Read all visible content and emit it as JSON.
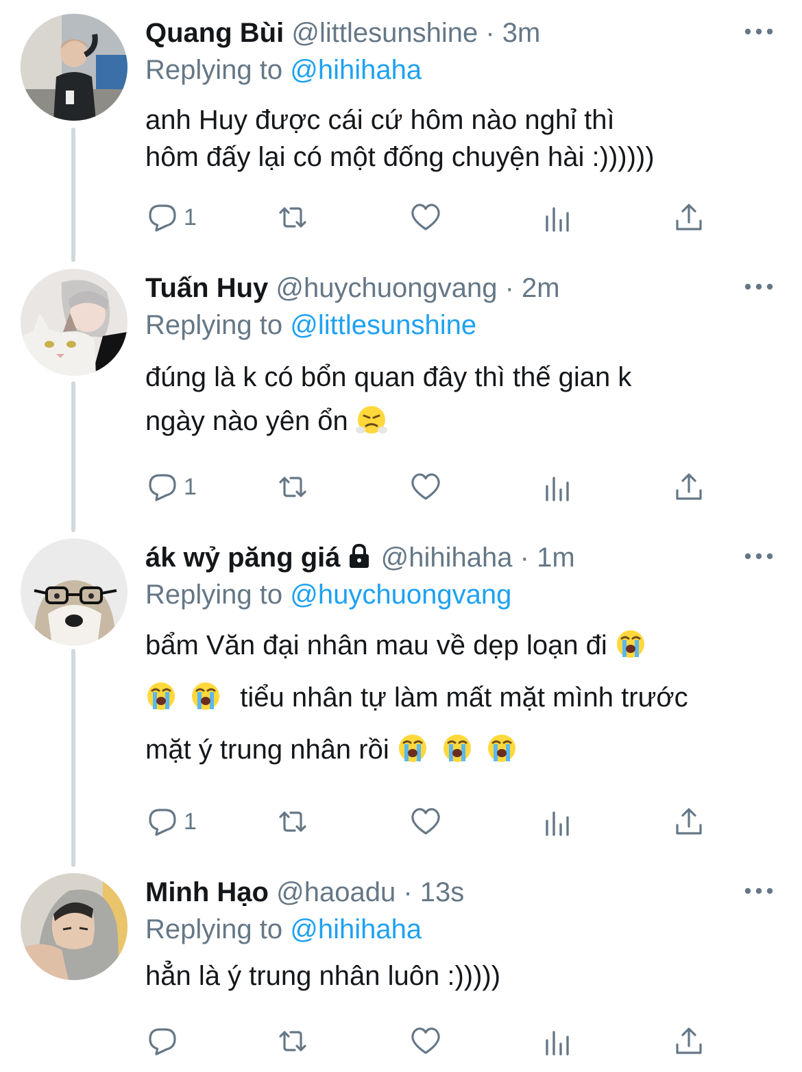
{
  "tweets": [
    {
      "display_name": "Quang Bùi",
      "handle": "@littlesunshine",
      "time": "3m",
      "separator": "·",
      "reply_prefix": "Replying to",
      "reply_to": "@hihihaha",
      "text_lines": [
        "anh Huy được cái cứ hôm nào nghỉ thì",
        "hôm đấy lại có một đống chuyện hài :))))))"
      ],
      "reply_count": "1"
    },
    {
      "display_name": "Tuấn Huy",
      "handle": "@huychuongvang",
      "time": "2m",
      "separator": "·",
      "reply_prefix": "Replying to",
      "reply_to": "@littlesunshine",
      "text_lines": [
        "đúng là k có bổn quan đây thì thế gian k",
        "ngày nào yên ổn"
      ],
      "emoji": "face-with-steam-from-nose",
      "reply_count": "1"
    },
    {
      "display_name": "ák wỷ păng giá",
      "locked": true,
      "handle": "@hihihaha",
      "time": "1m",
      "separator": "·",
      "reply_prefix": "Replying to",
      "reply_to": "@huychuongvang",
      "text_lines": [
        "bẩm Văn đại nhân mau về dẹp loạn đi",
        "tiểu nhân tự làm mất mặt mình trước",
        "mặt ý trung nhân rồi"
      ],
      "emoji": "loudly-crying-face",
      "reply_count": "1"
    },
    {
      "display_name": "Minh Hạo",
      "handle": "@haoadu",
      "time": "13s",
      "separator": "·",
      "reply_prefix": "Replying to",
      "reply_to": "@hihihaha",
      "text_lines": [
        "hẳn là ý trung nhân luôn :)))))"
      ],
      "reply_count": ""
    }
  ],
  "actions": [
    "reply-icon",
    "retweet-icon",
    "like-icon",
    "analytics-icon",
    "share-icon"
  ],
  "colors": {
    "link": "#1da1f2",
    "secondary": "#657786",
    "primary": "#14171a",
    "thread": "#cfd9de"
  }
}
